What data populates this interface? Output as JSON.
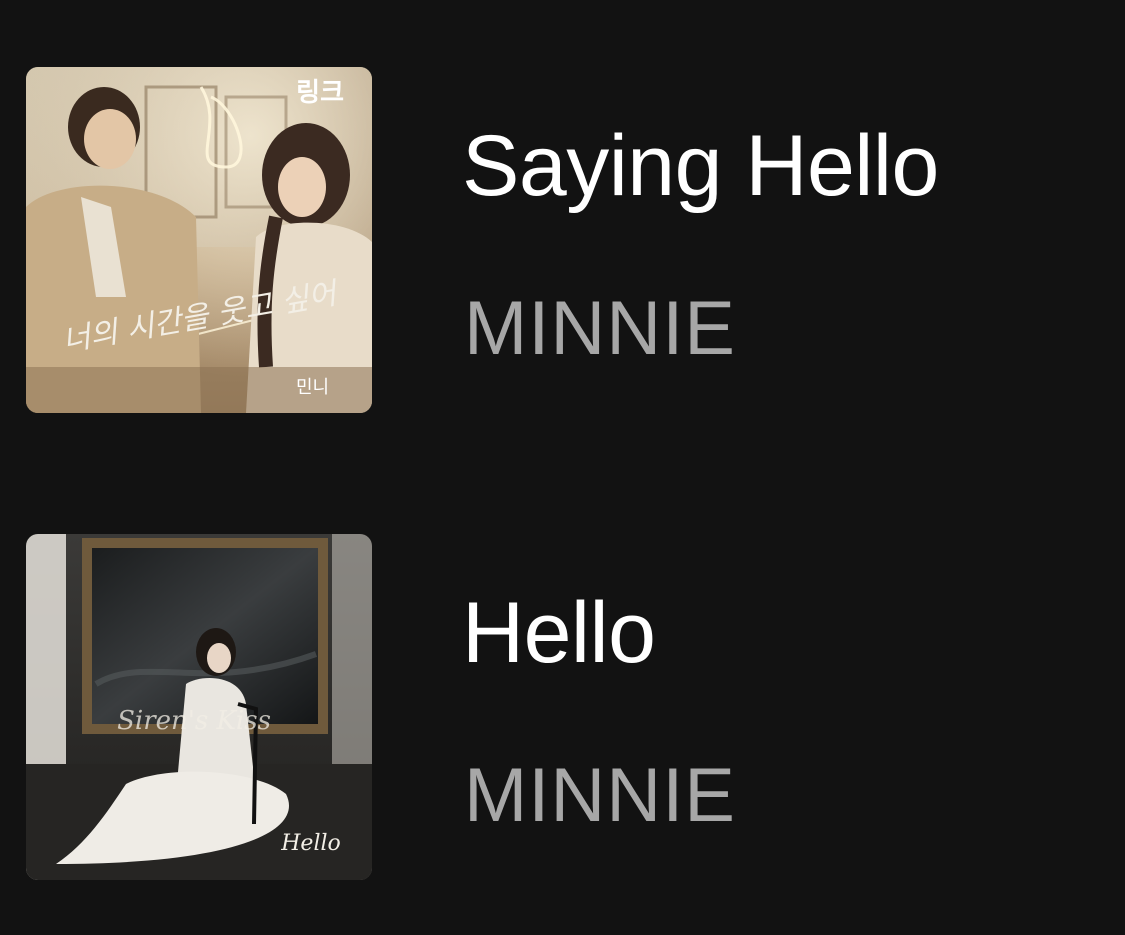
{
  "tracks": [
    {
      "title": "Saying Hello",
      "artist": "MINNIE",
      "cover": {
        "top_text": "링크",
        "center_text": "너의 시간을 웃고 싶어",
        "bottom_text": "민니"
      }
    },
    {
      "title": "Hello",
      "artist": "MINNIE",
      "cover": {
        "center_text": "Siren's Kiss",
        "bottom_text": "Hello"
      }
    }
  ],
  "colors": {
    "background": "#121212",
    "title": "#ffffff",
    "artist": "#a7a7a7"
  },
  "icons": {
    "cover_1": "album-art-saying-hello",
    "cover_2": "album-art-hello"
  }
}
